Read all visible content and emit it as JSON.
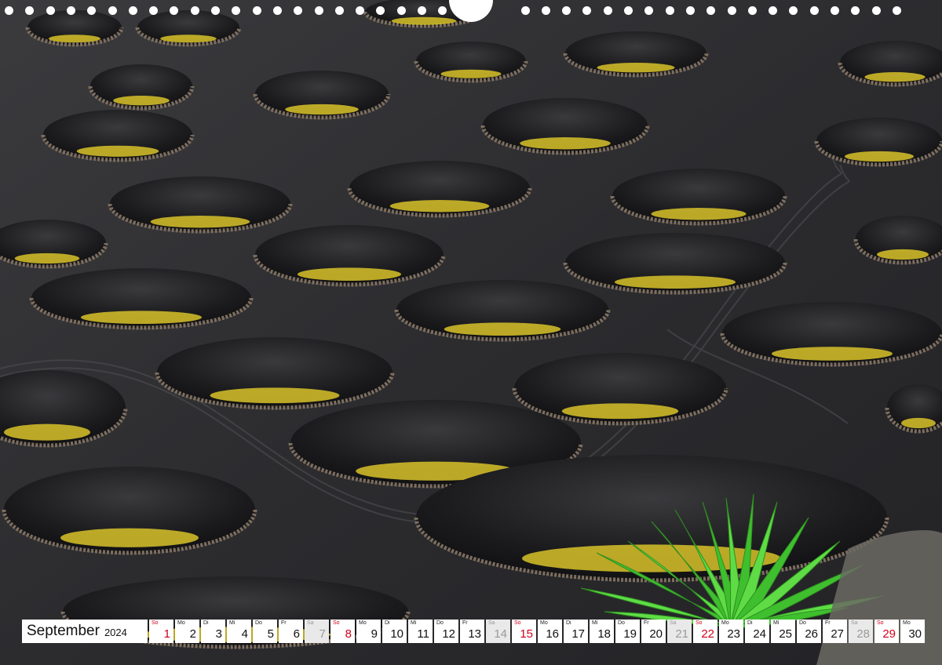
{
  "calendar": {
    "month": "September",
    "year": "2024",
    "days": [
      {
        "wd": "So",
        "d": "1",
        "kind": "sun"
      },
      {
        "wd": "Mo",
        "d": "2",
        "kind": "week"
      },
      {
        "wd": "Di",
        "d": "3",
        "kind": "week"
      },
      {
        "wd": "Mi",
        "d": "4",
        "kind": "week"
      },
      {
        "wd": "Do",
        "d": "5",
        "kind": "week"
      },
      {
        "wd": "Fr",
        "d": "6",
        "kind": "week"
      },
      {
        "wd": "Sa",
        "d": "7",
        "kind": "sat"
      },
      {
        "wd": "So",
        "d": "8",
        "kind": "sun"
      },
      {
        "wd": "Mo",
        "d": "9",
        "kind": "week"
      },
      {
        "wd": "Di",
        "d": "10",
        "kind": "week"
      },
      {
        "wd": "Mi",
        "d": "11",
        "kind": "week"
      },
      {
        "wd": "Do",
        "d": "12",
        "kind": "week"
      },
      {
        "wd": "Fr",
        "d": "13",
        "kind": "week"
      },
      {
        "wd": "Sa",
        "d": "14",
        "kind": "sat"
      },
      {
        "wd": "So",
        "d": "15",
        "kind": "sun"
      },
      {
        "wd": "Mo",
        "d": "16",
        "kind": "week"
      },
      {
        "wd": "Di",
        "d": "17",
        "kind": "week"
      },
      {
        "wd": "Mi",
        "d": "18",
        "kind": "week"
      },
      {
        "wd": "Do",
        "d": "19",
        "kind": "week"
      },
      {
        "wd": "Fr",
        "d": "20",
        "kind": "week"
      },
      {
        "wd": "Sa",
        "d": "21",
        "kind": "sat"
      },
      {
        "wd": "So",
        "d": "22",
        "kind": "sun"
      },
      {
        "wd": "Mo",
        "d": "23",
        "kind": "week"
      },
      {
        "wd": "Di",
        "d": "24",
        "kind": "week"
      },
      {
        "wd": "Mi",
        "d": "25",
        "kind": "week"
      },
      {
        "wd": "Do",
        "d": "26",
        "kind": "week"
      },
      {
        "wd": "Fr",
        "d": "27",
        "kind": "week"
      },
      {
        "wd": "Sa",
        "d": "28",
        "kind": "sat"
      },
      {
        "wd": "So",
        "d": "29",
        "kind": "sun"
      },
      {
        "wd": "Mo",
        "d": "30",
        "kind": "week"
      }
    ]
  },
  "colors": {
    "sunday": "#d0021b",
    "saturday_bg": "#e9e9e9",
    "volcanic_ash": "#2a2a2c",
    "vine_yellow": "#d8c229",
    "agave_green": "#4fcf3a"
  }
}
